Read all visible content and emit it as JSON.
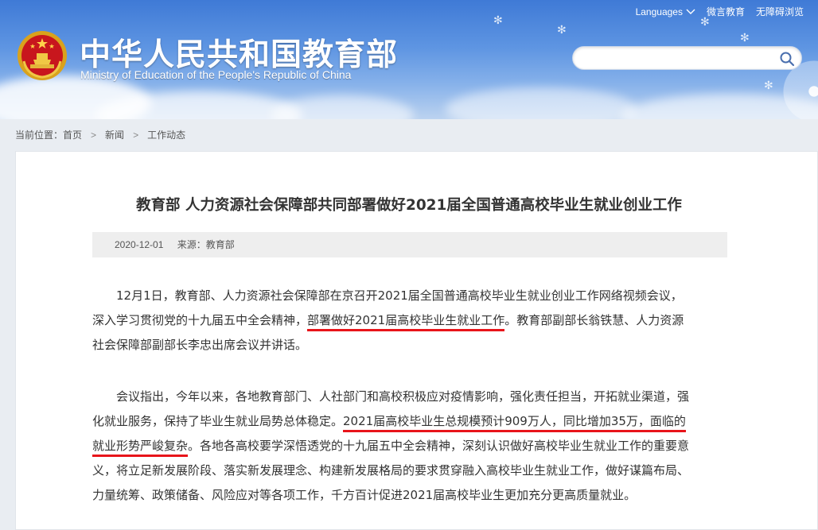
{
  "header": {
    "title_cn": "中华人民共和国教育部",
    "title_en": "Ministry of Education of the People's Republic of China",
    "links": {
      "languages": "Languages",
      "weiyan": "微言教育",
      "accessible": "无障碍浏览"
    },
    "search": {
      "placeholder": "",
      "value": ""
    }
  },
  "breadcrumb": {
    "prefix": "当前位置：",
    "items": [
      "首页",
      "新闻",
      "工作动态"
    ],
    "separator": ">"
  },
  "article": {
    "title": "教育部 人力资源社会保障部共同部署做好2021届全国普通高校毕业生就业创业工作",
    "date": "2020-12-01",
    "source": "来源：教育部",
    "p1": {
      "l1": "12月1日，教育部、人力资源社会保障部在京召开2021届全国普通高校毕业生就业创业工作网络视频会议，",
      "l2a": "深入学习贯彻党的十九届五中全会精神，",
      "l2b": "部署做好2021届高校毕业生就业工作",
      "l2c": "。教育部副部长翁铁慧、人力资源",
      "l3": "社会保障部副部长李忠出席会议并讲话。"
    },
    "p2": {
      "l1": "会议指出，今年以来，各地教育部门、人社部门和高校积极应对疫情影响，强化责任担当，开拓就业渠道，强",
      "l2a": "化就业服务，保持了毕业生就业局势总体稳定。",
      "l2b": "2021届高校毕业生总规模预计909万人，同比增加35万，面临的",
      "l3a": "就业形势严峻复杂",
      "l3b": "。各地各高校要学深悟透党的十九届五中全会精神，深刻认识做好高校毕业生就业工作的重要意",
      "l4": "义，将立足新发展阶段、落实新发展理念、构建新发展格局的要求贯穿融入高校毕业生就业工作，做好谋篇布局、",
      "l5": "力量统筹、政策储备、风险应对等各项工作，千方百计促进2021届高校毕业生更加充分更高质量就业。"
    }
  },
  "colors": {
    "banner_top": "#3f7ad6",
    "highlight_underline": "#e8141a",
    "text": "#333333"
  },
  "icons": {
    "emblem": "national-emblem-icon",
    "search": "search-icon",
    "dropdown": "chevron-down-icon"
  }
}
